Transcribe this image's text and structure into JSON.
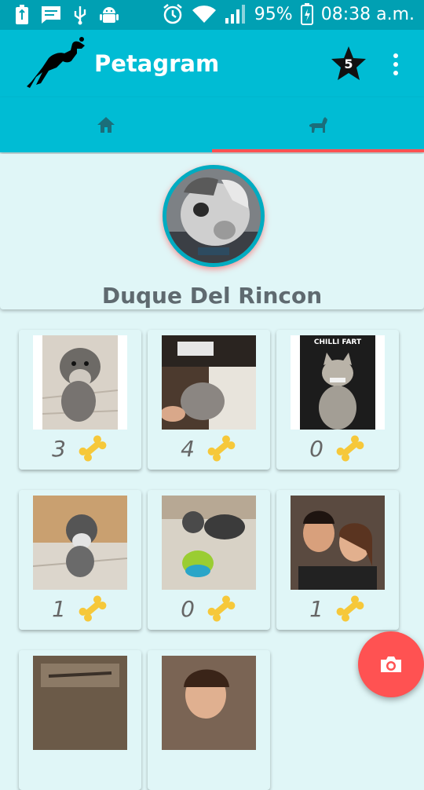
{
  "status_bar": {
    "battery_percent": "95%",
    "time": "08:38 a.m."
  },
  "app_bar": {
    "title": "Petagram",
    "favorites_count": "5"
  },
  "tabs": [
    {
      "icon": "home-icon"
    },
    {
      "icon": "dog-icon",
      "selected": true
    }
  ],
  "profile": {
    "name": "Duque Del Rincon"
  },
  "photos": [
    {
      "likes": "3",
      "photo_text": ""
    },
    {
      "likes": "4",
      "photo_text": ""
    },
    {
      "likes": "0",
      "photo_text": "CHILLI FART"
    },
    {
      "likes": "1",
      "photo_text": ""
    },
    {
      "likes": "0",
      "photo_text": ""
    },
    {
      "likes": "1",
      "photo_text": ""
    },
    {
      "likes": "",
      "photo_text": ""
    },
    {
      "likes": "",
      "photo_text": ""
    }
  ],
  "colors": {
    "primary": "#00bcd4",
    "status_bar": "#00a0b3",
    "accent": "#ff5252",
    "background": "#e0f6f7",
    "bone": "#f6c83a"
  }
}
